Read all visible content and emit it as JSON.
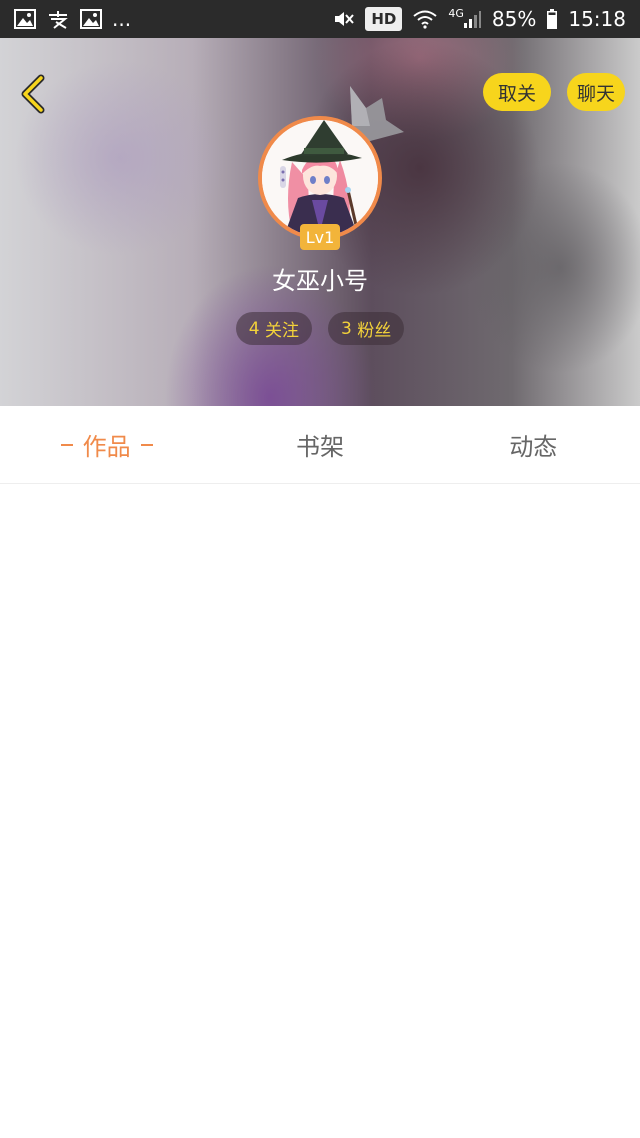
{
  "status_bar": {
    "notif_more": "...",
    "hd": "HD",
    "network": "4G",
    "battery": "85%",
    "time": "15:18",
    "icons": [
      "image-icon",
      "alipay-icon",
      "image-icon",
      "mute-icon",
      "wifi-icon",
      "signal-icon",
      "battery-icon"
    ]
  },
  "header": {
    "unfollow_label": "取关",
    "chat_label": "聊天",
    "level": "Lv1",
    "username": "女巫小号",
    "following_count": "4",
    "following_label": "关注",
    "followers_count": "3",
    "followers_label": "粉丝",
    "colors": {
      "accent_yellow": "#f7d51c",
      "avatar_border": "#f08a4a",
      "level_badge": "#f2b43a"
    }
  },
  "tabs": [
    {
      "label": "作品",
      "active": true
    },
    {
      "label": "书架",
      "active": false
    },
    {
      "label": "动态",
      "active": false
    }
  ],
  "colors": {
    "active_tab": "#f08a4a",
    "inactive_tab": "#666666"
  }
}
